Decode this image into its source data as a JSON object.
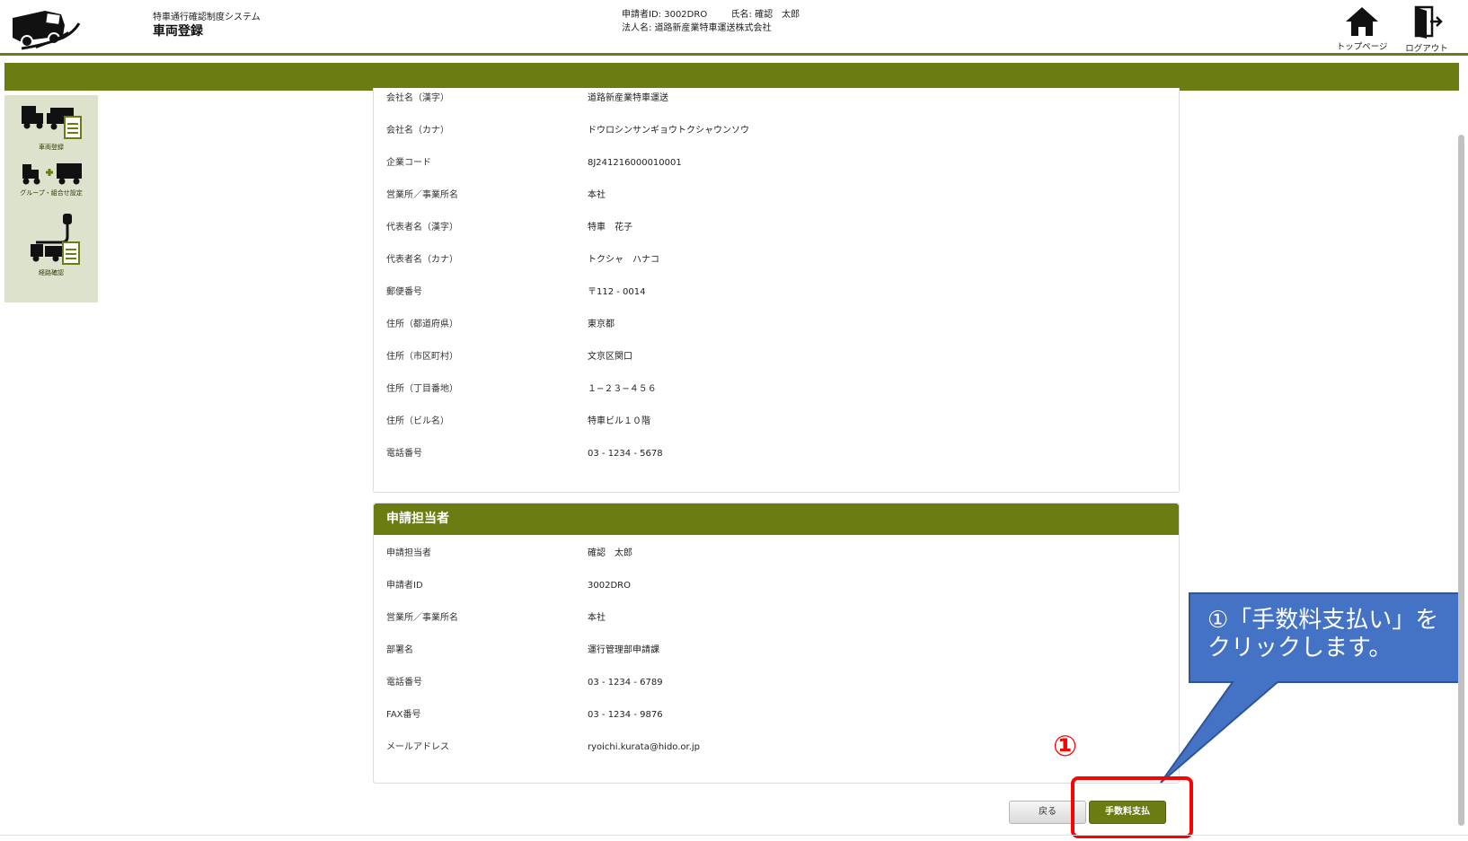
{
  "header": {
    "system_name": "特車通行確認制度システム",
    "page_title": "車両登録",
    "applicant_id_label": "申請者ID:",
    "applicant_id": "3002DRO",
    "name_label": "氏名:",
    "name": "確認　太郎",
    "corp_label": "法人名:",
    "corp_name": "道路新産業特車運送株式会社",
    "top_page": "トップページ",
    "logout": "ログアウト"
  },
  "sidebar": {
    "items": [
      {
        "label": "車両登録",
        "icon": "truck-document-icon"
      },
      {
        "label": "グループ・組合せ設定",
        "icon": "truck-combination-icon"
      },
      {
        "label": "経路確認",
        "icon": "route-check-icon"
      }
    ]
  },
  "company": {
    "rows": [
      {
        "key": "会社名（漢字）",
        "value": "道路新産業特車運送"
      },
      {
        "key": "会社名（カナ）",
        "value": "ドウロシンサンギョウトクシャウンソウ"
      },
      {
        "key": "企業コード",
        "value": "8J241216000010001"
      },
      {
        "key": "営業所／事業所名",
        "value": "本社"
      },
      {
        "key": "代表者名（漢字）",
        "value": "特車　花子"
      },
      {
        "key": "代表者名（カナ）",
        "value": "トクシャ　ハナコ"
      },
      {
        "key": "郵便番号",
        "value": "〒112 - 0014"
      },
      {
        "key": "住所（都道府県）",
        "value": "東京都"
      },
      {
        "key": "住所（市区町村）",
        "value": "文京区関口"
      },
      {
        "key": "住所（丁目番地）",
        "value": "１−２３−４５６"
      },
      {
        "key": "住所（ビル名）",
        "value": "特車ビル１０階"
      },
      {
        "key": "電話番号",
        "value": "03 - 1234 - 5678"
      }
    ]
  },
  "applicant": {
    "title": "申請担当者",
    "rows": [
      {
        "key": "申請担当者",
        "value": "確認　太郎"
      },
      {
        "key": "申請者ID",
        "value": "3002DRO"
      },
      {
        "key": "営業所／事業所名",
        "value": "本社"
      },
      {
        "key": "部署名",
        "value": "運行管理部申請課"
      },
      {
        "key": "電話番号",
        "value": "03 - 1234 - 6789"
      },
      {
        "key": "FAX番号",
        "value": "03 - 1234 - 9876"
      },
      {
        "key": "メールアドレス",
        "value": "ryoichi.kurata@hido.or.jp"
      }
    ]
  },
  "buttons": {
    "back": "戻る",
    "pay": "手数料支払"
  },
  "annotation": {
    "step": "①",
    "callout_line1": "①「手数料支払い」を",
    "callout_line2": "クリックします。",
    "highlight_color": "#ff0000",
    "callout_color": "#4472c4"
  },
  "colors": {
    "accent": "#6b7d12",
    "sidebar_bg": "#dde2cc"
  }
}
